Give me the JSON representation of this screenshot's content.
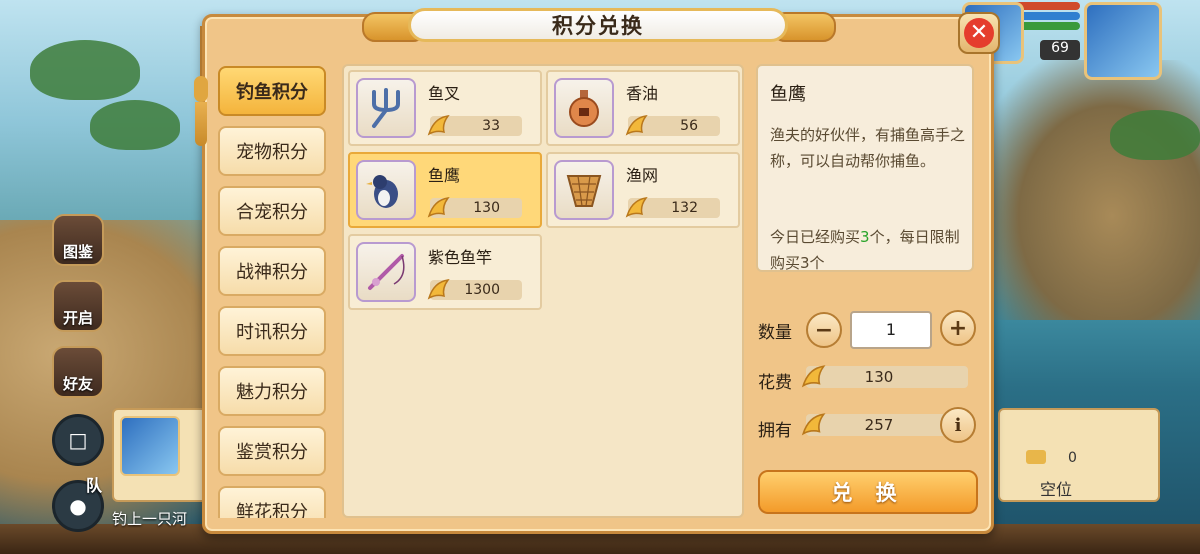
{
  "dialog": {
    "title": "积分兑换"
  },
  "tabs": [
    {
      "label": "钓鱼积分",
      "active": true
    },
    {
      "label": "宠物积分",
      "active": false
    },
    {
      "label": "合宠积分",
      "active": false
    },
    {
      "label": "战神积分",
      "active": false
    },
    {
      "label": "时讯积分",
      "active": false
    },
    {
      "label": "魅力积分",
      "active": false
    },
    {
      "label": "鉴赏积分",
      "active": false
    },
    {
      "label": "鲜花积分",
      "active": false
    }
  ],
  "items": [
    {
      "name": "鱼叉",
      "price": "33",
      "icon": "trident-icon",
      "selected": false
    },
    {
      "name": "香油",
      "price": "56",
      "icon": "oil-bottle-icon",
      "selected": false
    },
    {
      "name": "鱼鹰",
      "price": "130",
      "icon": "cormorant-icon",
      "selected": true
    },
    {
      "name": "渔网",
      "price": "132",
      "icon": "fishing-net-icon",
      "selected": false
    },
    {
      "name": "紫色鱼竿",
      "price": "1300",
      "icon": "purple-fishing-rod-icon",
      "selected": false
    }
  ],
  "detail": {
    "name": "鱼鹰",
    "description": "渔夫的好伙伴，有捕鱼高手之称，可以自动帮你捕鱼。",
    "limit_prefix": "今日已经购买",
    "limit_count": "3",
    "limit_suffix": "个，每日限制购买3个"
  },
  "purchase": {
    "quantity_label": "数量",
    "quantity": "1",
    "cost_label": "花费",
    "cost": "130",
    "owned_label": "拥有",
    "owned": "257",
    "exchange_label": "兑 换"
  },
  "hud": {
    "book_label": "图鉴",
    "open_label": "开启",
    "friends_label": "好友",
    "team_label": "队",
    "chat_message": "钓上一只河",
    "level": "69",
    "slot_zero": "0",
    "slot_empty": "空位"
  },
  "colors": {
    "accent": "#f4b43c",
    "dialog_bg": "#f0c588",
    "close_red": "#e53d2d",
    "highlight_green": "#2aa42a"
  }
}
